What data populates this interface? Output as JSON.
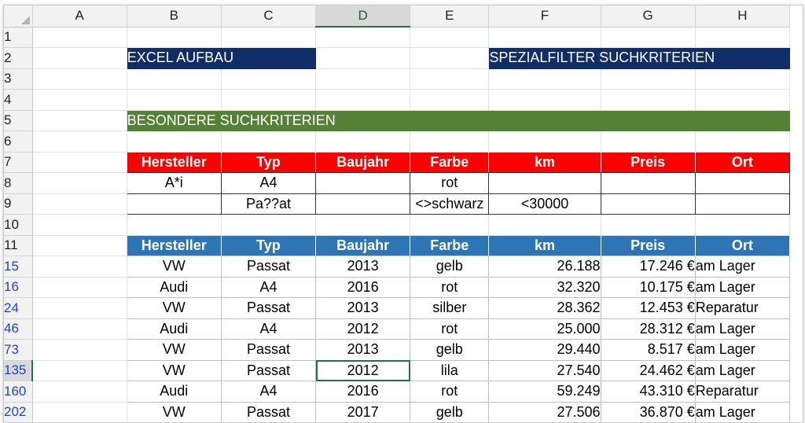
{
  "columns": [
    "A",
    "B",
    "C",
    "D",
    "E",
    "F",
    "G",
    "H"
  ],
  "rows": {
    "r1": "1",
    "r2": "2",
    "r3": "3",
    "r4": "4",
    "r5": "5",
    "r6": "6",
    "r7": "7",
    "r8": "8",
    "r9": "9",
    "r10": "10",
    "r11": "11",
    "r15": "15",
    "r16": "16",
    "r24": "24",
    "r46": "46",
    "r73": "73",
    "r135": "135",
    "r160": "160",
    "r202": "202"
  },
  "banners": {
    "excel_aufbau": "EXCEL AUFBAU",
    "spezialfilter": "SPEZIALFILTER SUCHKRITERIEN",
    "besondere": "BESONDERE SUCHKRITERIEN"
  },
  "headers": [
    "Hersteller",
    "Typ",
    "Baujahr",
    "Farbe",
    "km",
    "Preis",
    "Ort"
  ],
  "criteria": [
    [
      "A*i",
      "A4",
      "",
      "rot",
      "",
      "",
      ""
    ],
    [
      "",
      "Pa??at",
      "",
      "<>schwarz",
      "<30000",
      "",
      ""
    ]
  ],
  "results": [
    [
      "VW",
      "Passat",
      "2013",
      "gelb",
      "26.188",
      "17.246 €",
      "am Lager"
    ],
    [
      "Audi",
      "A4",
      "2016",
      "rot",
      "32.320",
      "10.175 €",
      "am Lager"
    ],
    [
      "VW",
      "Passat",
      "2013",
      "silber",
      "28.362",
      "12.453 €",
      "Reparatur"
    ],
    [
      "Audi",
      "A4",
      "2012",
      "rot",
      "25.000",
      "28.312 €",
      "am Lager"
    ],
    [
      "VW",
      "Passat",
      "2013",
      "gelb",
      "29.440",
      "8.517 €",
      "am Lager"
    ],
    [
      "VW",
      "Passat",
      "2012",
      "lila",
      "27.540",
      "24.462 €",
      "am Lager"
    ],
    [
      "Audi",
      "A4",
      "2016",
      "rot",
      "59.249",
      "43.310 €",
      "Reparatur"
    ],
    [
      "VW",
      "Passat",
      "2017",
      "gelb",
      "27.506",
      "36.870 €",
      "am Lager"
    ]
  ],
  "colors": {
    "banner_blue": "#0f2d69",
    "banner_green": "#548235",
    "criteria_header": "#ff0000",
    "result_header": "#2e75b6",
    "selection": "#217346",
    "filtered_row_number": "#1a43d8"
  }
}
